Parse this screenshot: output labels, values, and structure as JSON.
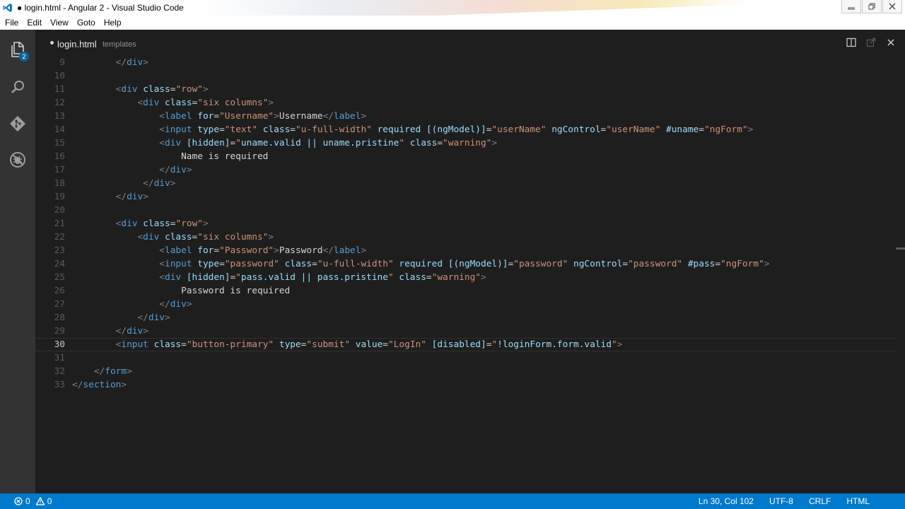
{
  "window": {
    "title": "● login.html - Angular 2 - Visual Studio Code"
  },
  "menu": [
    "File",
    "Edit",
    "View",
    "Goto",
    "Help"
  ],
  "activity": {
    "explorer_badge": "2",
    "icons": [
      "files-icon",
      "search-icon",
      "git-icon",
      "debug-icon"
    ]
  },
  "tab": {
    "name": "login.html",
    "directory": "templates",
    "dirty": true
  },
  "editor": {
    "current_line": "30",
    "lines": [
      {
        "n": "9",
        "tokens": [
          [
            "text",
            "        "
          ],
          [
            "punct",
            "</"
          ],
          [
            "tag",
            "div"
          ],
          [
            "punct",
            ">"
          ]
        ]
      },
      {
        "n": "10",
        "tokens": []
      },
      {
        "n": "11",
        "tokens": [
          [
            "text",
            "        "
          ],
          [
            "punct",
            "<"
          ],
          [
            "tag",
            "div"
          ],
          [
            "text",
            " "
          ],
          [
            "attr",
            "class"
          ],
          [
            "text",
            "="
          ],
          [
            "str",
            "\"row\""
          ],
          [
            "punct",
            ">"
          ]
        ]
      },
      {
        "n": "12",
        "tokens": [
          [
            "text",
            "            "
          ],
          [
            "punct",
            "<"
          ],
          [
            "tag",
            "div"
          ],
          [
            "text",
            " "
          ],
          [
            "attr",
            "class"
          ],
          [
            "text",
            "="
          ],
          [
            "str",
            "\"six columns\""
          ],
          [
            "punct",
            ">"
          ]
        ]
      },
      {
        "n": "13",
        "tokens": [
          [
            "text",
            "                "
          ],
          [
            "punct",
            "<"
          ],
          [
            "tag",
            "label"
          ],
          [
            "text",
            " "
          ],
          [
            "attr",
            "for"
          ],
          [
            "text",
            "="
          ],
          [
            "str",
            "\"Username\""
          ],
          [
            "punct",
            ">"
          ],
          [
            "text",
            "Username"
          ],
          [
            "punct",
            "</"
          ],
          [
            "tag",
            "label"
          ],
          [
            "punct",
            ">"
          ]
        ]
      },
      {
        "n": "14",
        "tokens": [
          [
            "text",
            "                "
          ],
          [
            "punct",
            "<"
          ],
          [
            "tag",
            "input"
          ],
          [
            "text",
            " "
          ],
          [
            "attr",
            "type"
          ],
          [
            "text",
            "="
          ],
          [
            "str",
            "\"text\""
          ],
          [
            "text",
            " "
          ],
          [
            "attr",
            "class"
          ],
          [
            "text",
            "="
          ],
          [
            "str",
            "\"u-full-width\""
          ],
          [
            "text",
            " "
          ],
          [
            "attr",
            "required"
          ],
          [
            "text",
            " "
          ],
          [
            "attr",
            "[(ngModel)]"
          ],
          [
            "text",
            "="
          ],
          [
            "str",
            "\"userName\""
          ],
          [
            "text",
            " "
          ],
          [
            "attr",
            "ngControl"
          ],
          [
            "text",
            "="
          ],
          [
            "str",
            "\"userName\""
          ],
          [
            "text",
            " "
          ],
          [
            "attr",
            "#uname"
          ],
          [
            "text",
            "="
          ],
          [
            "str",
            "\"ngForm\""
          ],
          [
            "punct",
            ">"
          ]
        ]
      },
      {
        "n": "15",
        "tokens": [
          [
            "text",
            "                "
          ],
          [
            "punct",
            "<"
          ],
          [
            "tag",
            "div"
          ],
          [
            "text",
            " "
          ],
          [
            "attr",
            "[hidden]"
          ],
          [
            "text",
            "="
          ],
          [
            "str",
            "\""
          ],
          [
            "attr",
            "uname.valid || uname.pristine"
          ],
          [
            "str",
            "\""
          ],
          [
            "text",
            " "
          ],
          [
            "attr",
            "class"
          ],
          [
            "text",
            "="
          ],
          [
            "str",
            "\"warning\""
          ],
          [
            "punct",
            ">"
          ]
        ]
      },
      {
        "n": "16",
        "tokens": [
          [
            "text",
            "                    Name is required"
          ]
        ]
      },
      {
        "n": "17",
        "tokens": [
          [
            "text",
            "                "
          ],
          [
            "punct",
            "</"
          ],
          [
            "tag",
            "div"
          ],
          [
            "punct",
            ">"
          ]
        ]
      },
      {
        "n": "18",
        "tokens": [
          [
            "text",
            "             "
          ],
          [
            "punct",
            "</"
          ],
          [
            "tag",
            "div"
          ],
          [
            "punct",
            ">"
          ]
        ]
      },
      {
        "n": "19",
        "tokens": [
          [
            "text",
            "        "
          ],
          [
            "punct",
            "</"
          ],
          [
            "tag",
            "div"
          ],
          [
            "punct",
            ">"
          ]
        ]
      },
      {
        "n": "20",
        "tokens": []
      },
      {
        "n": "21",
        "tokens": [
          [
            "text",
            "        "
          ],
          [
            "punct",
            "<"
          ],
          [
            "tag",
            "div"
          ],
          [
            "text",
            " "
          ],
          [
            "attr",
            "class"
          ],
          [
            "text",
            "="
          ],
          [
            "str",
            "\"row\""
          ],
          [
            "punct",
            ">"
          ]
        ]
      },
      {
        "n": "22",
        "tokens": [
          [
            "text",
            "            "
          ],
          [
            "punct",
            "<"
          ],
          [
            "tag",
            "div"
          ],
          [
            "text",
            " "
          ],
          [
            "attr",
            "class"
          ],
          [
            "text",
            "="
          ],
          [
            "str",
            "\"six columns\""
          ],
          [
            "punct",
            ">"
          ]
        ]
      },
      {
        "n": "23",
        "tokens": [
          [
            "text",
            "                "
          ],
          [
            "punct",
            "<"
          ],
          [
            "tag",
            "label"
          ],
          [
            "text",
            " "
          ],
          [
            "attr",
            "for"
          ],
          [
            "text",
            "="
          ],
          [
            "str",
            "\"Password\""
          ],
          [
            "punct",
            ">"
          ],
          [
            "text",
            "Password"
          ],
          [
            "punct",
            "</"
          ],
          [
            "tag",
            "label"
          ],
          [
            "punct",
            ">"
          ]
        ]
      },
      {
        "n": "24",
        "tokens": [
          [
            "text",
            "                "
          ],
          [
            "punct",
            "<"
          ],
          [
            "tag",
            "input"
          ],
          [
            "text",
            " "
          ],
          [
            "attr",
            "type"
          ],
          [
            "text",
            "="
          ],
          [
            "str",
            "\"password\""
          ],
          [
            "text",
            " "
          ],
          [
            "attr",
            "class"
          ],
          [
            "text",
            "="
          ],
          [
            "str",
            "\"u-full-width\""
          ],
          [
            "text",
            " "
          ],
          [
            "attr",
            "required"
          ],
          [
            "text",
            " "
          ],
          [
            "attr",
            "[(ngModel)]"
          ],
          [
            "text",
            "="
          ],
          [
            "str",
            "\"password\""
          ],
          [
            "text",
            " "
          ],
          [
            "attr",
            "ngControl"
          ],
          [
            "text",
            "="
          ],
          [
            "str",
            "\"password\""
          ],
          [
            "text",
            " "
          ],
          [
            "attr",
            "#pass"
          ],
          [
            "text",
            "="
          ],
          [
            "str",
            "\"ngForm\""
          ],
          [
            "punct",
            ">"
          ]
        ]
      },
      {
        "n": "25",
        "tokens": [
          [
            "text",
            "                "
          ],
          [
            "punct",
            "<"
          ],
          [
            "tag",
            "div"
          ],
          [
            "text",
            " "
          ],
          [
            "attr",
            "[hidden]"
          ],
          [
            "text",
            "="
          ],
          [
            "str",
            "\""
          ],
          [
            "attr",
            "pass.valid || pass.pristine"
          ],
          [
            "str",
            "\""
          ],
          [
            "text",
            " "
          ],
          [
            "attr",
            "class"
          ],
          [
            "text",
            "="
          ],
          [
            "str",
            "\"warning\""
          ],
          [
            "punct",
            ">"
          ]
        ]
      },
      {
        "n": "26",
        "tokens": [
          [
            "text",
            "                    Password is required"
          ]
        ]
      },
      {
        "n": "27",
        "tokens": [
          [
            "text",
            "                "
          ],
          [
            "punct",
            "</"
          ],
          [
            "tag",
            "div"
          ],
          [
            "punct",
            ">"
          ]
        ]
      },
      {
        "n": "28",
        "tokens": [
          [
            "text",
            "            "
          ],
          [
            "punct",
            "</"
          ],
          [
            "tag",
            "div"
          ],
          [
            "punct",
            ">"
          ]
        ]
      },
      {
        "n": "29",
        "tokens": [
          [
            "text",
            "        "
          ],
          [
            "punct",
            "</"
          ],
          [
            "tag",
            "div"
          ],
          [
            "punct",
            ">"
          ]
        ]
      },
      {
        "n": "30",
        "tokens": [
          [
            "text",
            "        "
          ],
          [
            "punct",
            "<"
          ],
          [
            "tag",
            "input"
          ],
          [
            "text",
            " "
          ],
          [
            "attr",
            "class"
          ],
          [
            "text",
            "="
          ],
          [
            "str",
            "\"button-primary\""
          ],
          [
            "text",
            " "
          ],
          [
            "attr",
            "type"
          ],
          [
            "text",
            "="
          ],
          [
            "str",
            "\"submit\""
          ],
          [
            "text",
            " "
          ],
          [
            "attr",
            "value"
          ],
          [
            "text",
            "="
          ],
          [
            "str",
            "\"LogIn\""
          ],
          [
            "text",
            " "
          ],
          [
            "attr",
            "[disabled]"
          ],
          [
            "text",
            "="
          ],
          [
            "str",
            "\""
          ],
          [
            "attr",
            "!loginForm.form.valid"
          ],
          [
            "str",
            "\""
          ],
          [
            "punct",
            ">"
          ]
        ]
      },
      {
        "n": "31",
        "tokens": []
      },
      {
        "n": "32",
        "tokens": [
          [
            "text",
            "    "
          ],
          [
            "punct",
            "</"
          ],
          [
            "tag",
            "form"
          ],
          [
            "punct",
            ">"
          ]
        ]
      },
      {
        "n": "33",
        "tokens": [
          [
            "punct",
            "</"
          ],
          [
            "tag",
            "section"
          ],
          [
            "punct",
            ">"
          ]
        ]
      }
    ]
  },
  "status": {
    "errors": "0",
    "warnings": "0",
    "position": "Ln 30, Col 102",
    "encoding": "UTF-8",
    "eol": "CRLF",
    "language": "HTML"
  },
  "colors": {
    "statusbar": "#007acc",
    "activitybar": "#333333",
    "editor_bg": "#1e1e1e",
    "tag": "#569cd6",
    "attr": "#9cdcfe",
    "string": "#ce9178"
  }
}
